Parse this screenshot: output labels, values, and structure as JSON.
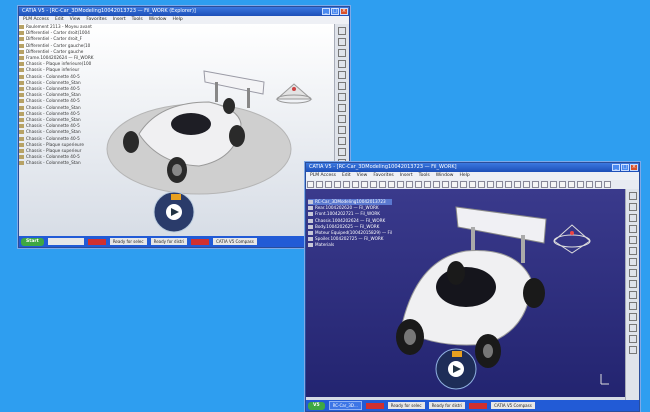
{
  "window1": {
    "title": "CATIA V5 - [RC-Car_3DModeling10042013723 — Fil_WORK (Explorer)]",
    "menu": [
      "PLM Access",
      "Edit",
      "View",
      "Favorites",
      "Insert",
      "Tools",
      "Window",
      "Help"
    ],
    "tree": [
      "Roulement 2113 - Moyeu avant",
      "Differentiel - Carter droit(1004",
      "Differentiel - Carter droit_F",
      "Differentiel - Carter gauche(10",
      "Differentiel - Carter gauche",
      "Frame.1004202624 — Fil_WORK",
      "Chassis - Plaque inferieure(100",
      "Chassis - Plaque inferieur",
      "Chassis - Colonnette 40-5",
      "Chassis - Colonnette_Stan",
      "Chassis - Colonnette 40-5",
      "Chassis - Colonnette_Stan",
      "Chassis - Colonnette 40-5",
      "Chassis - Colonnette_Stan",
      "Chassis - Colonnette 40-5",
      "Chassis - Colonnette_Stan",
      "Chassis - Colonnette 40-5",
      "Chassis - Colonnette_Stan",
      "Chassis - Colonnette 40-5",
      "Chassis - Plaque superieure",
      "Chassis - Plaque superieur",
      "Chassis - Colonnette 40-5",
      "Chassis - Colonnette_Stan"
    ],
    "taskbar": {
      "start": "Start",
      "search": "",
      "status1": "Ready for selec",
      "status2": "Ready for distri",
      "status3": "CATIA V5 Compass"
    }
  },
  "window2": {
    "title": "CATIA V5 - [RC-Car_3DModeling10042013723 — Fil_WORK]",
    "menu": [
      "PLM Access",
      "Edit",
      "View",
      "Favorites",
      "Insert",
      "Tools",
      "Window",
      "Help"
    ],
    "tree": [
      "RC-Car_3DModeling10042013723",
      "Rear.1004202620 — Fil_WORK",
      "Front.1004202721 — Fil_WORK",
      "Chassis.1004202624 — Fil_WORK",
      "Body.1004202625 — Fil_WORK",
      "Moteur Equiped(10042015829) — Fil",
      "Spoiler.1004202725 — Fil_WORK",
      "Materials"
    ],
    "taskbar": {
      "start": "V5",
      "task1": "RC-Car_3D...",
      "task2": "Ready for selec",
      "status1": "Ready for distri",
      "status2": "CATIA V5 Compass",
      "status3": "CATIA V5 Compass"
    }
  },
  "colors": {
    "desktop": "#2e9ef0",
    "viewport_dark": "#2b2b7a",
    "titlebar": "#2a5fcf",
    "error": "#d03030"
  }
}
